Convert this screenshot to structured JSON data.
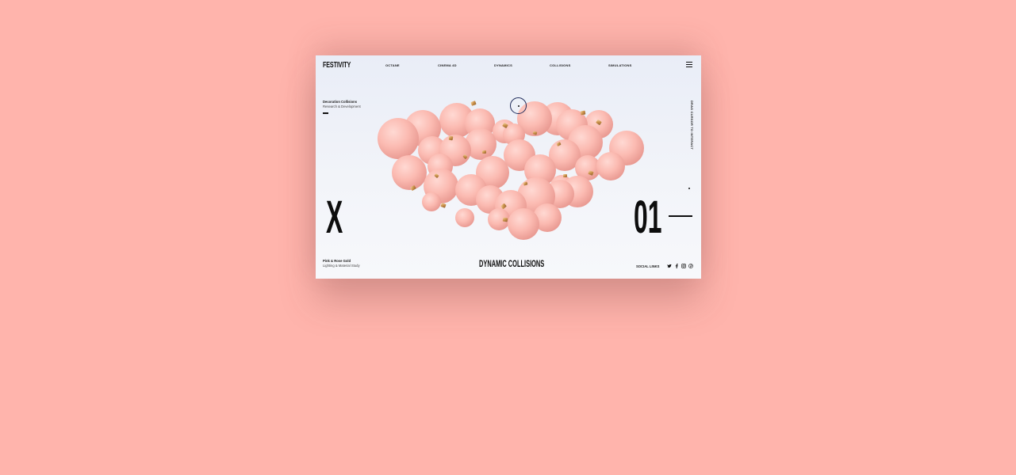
{
  "brand": {
    "logo": "FESTIVITY"
  },
  "nav": {
    "items": [
      "OCTANE",
      "CINEMA 4D",
      "DYNAMICS",
      "COLLISIONS",
      "SIMULATIONS"
    ]
  },
  "intro": {
    "title": "Decoration Collisions",
    "subtitle": "Research & Development"
  },
  "hint": {
    "text": "DRAG CURSOR TO INTERACT"
  },
  "hero": {
    "mark": "X",
    "counter": "01"
  },
  "footer": {
    "left_title": "Pink & Rose Gold",
    "left_subtitle": "Lighting & Material Study",
    "center_title": "DYNAMIC COLLISIONS",
    "social_label": "SOCIAL LINKS",
    "social_icons": [
      "twitter-icon",
      "facebook-icon",
      "instagram-icon",
      "pinterest-icon"
    ]
  },
  "colors": {
    "page_background": "#ffb4ac",
    "ornament_pink": "#f9b8b0",
    "ornament_cap": "#d9a45a",
    "text": "#0d0d0d"
  }
}
